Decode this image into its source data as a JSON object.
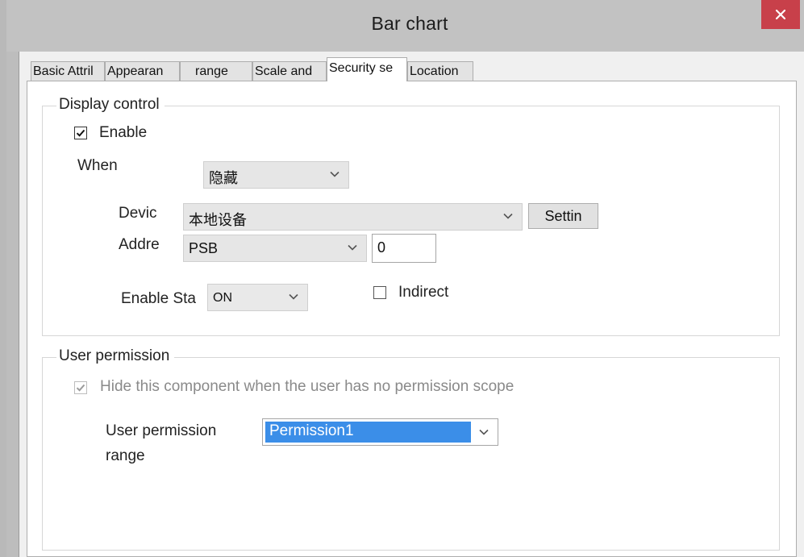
{
  "window": {
    "title": "Bar chart"
  },
  "tabs": [
    {
      "label": "Basic Attril",
      "active": false
    },
    {
      "label": "Appearan",
      "active": false
    },
    {
      "label": "range",
      "active": false
    },
    {
      "label": "Scale and",
      "active": false
    },
    {
      "label": "Security se",
      "active": true
    },
    {
      "label": "Location",
      "active": false
    }
  ],
  "display_control": {
    "legend": "Display control",
    "enable_label": "Enable",
    "enable_checked": true,
    "when_label": "When",
    "when_value": "隐藏",
    "device_label": "Devic",
    "device_value": "本地设备",
    "settings_button": "Settin",
    "address_label": "Addre",
    "address_type": "PSB",
    "address_value": "0",
    "enable_state_label": "Enable Sta",
    "enable_state_value": "ON",
    "indirect_label": "Indirect",
    "indirect_checked": false
  },
  "user_permission": {
    "legend": "User permission",
    "hide_label": "Hide this component when the user has no permission scope",
    "hide_checked": true,
    "range_label_line1": "User permission",
    "range_label_line2": "range",
    "range_value": "Permission1"
  },
  "colors": {
    "close_button": "#c8404a",
    "selection_highlight": "#3b8ee8"
  },
  "icons": [
    "close-icon",
    "chevron-down-icon",
    "checkmark-icon"
  ]
}
